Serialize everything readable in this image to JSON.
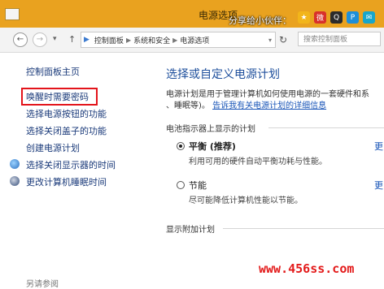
{
  "window": {
    "title": "电源选项"
  },
  "share": {
    "label": "分享给小伙伴：",
    "icons": [
      {
        "name": "qzone-star-icon",
        "color": "#f2b51a",
        "glyph": "★"
      },
      {
        "name": "weibo-icon",
        "color": "#d8302b",
        "glyph": "微"
      },
      {
        "name": "qq-icon",
        "color": "#2b2b2b",
        "glyph": "Q"
      },
      {
        "name": "paipai-icon",
        "color": "#1f8fd8",
        "glyph": "P"
      },
      {
        "name": "tencent-weibo-icon",
        "color": "#18a6c9",
        "glyph": "✉"
      }
    ]
  },
  "nav": {
    "back": "←",
    "forward": "→",
    "recent": "▾",
    "up": "↑",
    "breadcrumb": [
      "控制面板",
      "系统和安全",
      "电源选项"
    ],
    "refresh": "↻",
    "search_placeholder": "搜索控制面板"
  },
  "sidebar": {
    "home": "控制面板主页",
    "links": [
      "唤醒时需要密码",
      "选择电源按钮的功能",
      "选择关闭盖子的功能",
      "创建电源计划",
      "选择关闭显示器的时间",
      "更改计算机睡眠时间"
    ],
    "bottom": "另请参阅"
  },
  "main": {
    "title": "选择或自定义电源计划",
    "desc_line1": "电源计划是用于管理计算机如何使用电源的一套硬件和系",
    "desc_line2_prefix": "、睡眠等)。",
    "desc_line2_link": "告诉我有关电源计划的详细信息",
    "group_head": "电池指示器上显示的计划",
    "plans": [
      {
        "name": "平衡 (推荐)",
        "desc": "利用可用的硬件自动平衡功耗与性能。",
        "selected": true,
        "link": "更"
      },
      {
        "name": "节能",
        "desc": "尽可能降低计算机性能以节能。",
        "selected": false,
        "link": "更"
      }
    ],
    "additional": "显示附加计划"
  },
  "watermark": "www.456ss.com",
  "colors": {
    "titlebar": "#e9a21f",
    "link": "#1a3a7a",
    "heading": "#1e4f9c",
    "highlight": "#e3141b"
  }
}
